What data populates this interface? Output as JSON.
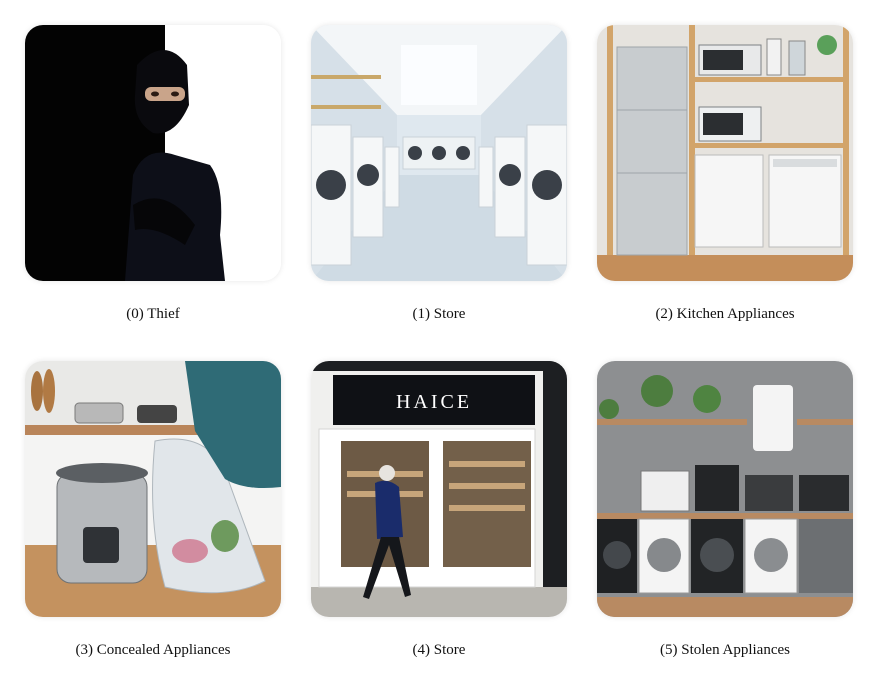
{
  "panels": [
    {
      "caption": "(0) Thief"
    },
    {
      "caption": "(1) Store"
    },
    {
      "caption": "(2) Kitchen Appliances"
    },
    {
      "caption": "(3) Concealed Appliances"
    },
    {
      "caption": "(4) Store",
      "sign_text": "HAICE"
    },
    {
      "caption": "(5) Stolen Appliances"
    }
  ]
}
